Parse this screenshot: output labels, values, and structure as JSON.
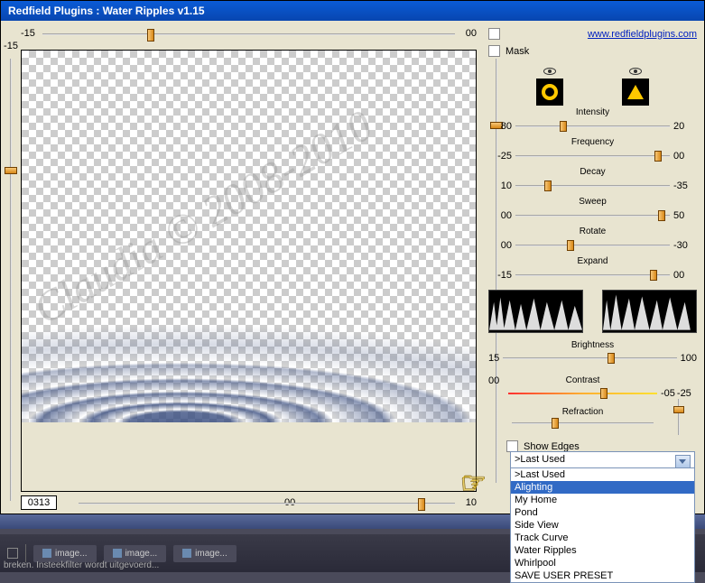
{
  "title": "Redfield Plugins : Water Ripples v1.15",
  "url": "www.redfieldplugins.com",
  "mask_label": "Mask",
  "show_edges_label": "Show Edges",
  "watermark": "Claudia © 2008-2010",
  "counter": "0313",
  "top_slider": {
    "left": "-15",
    "right": "00"
  },
  "left_slider": {
    "label": "-15"
  },
  "bottom_slider": {
    "left": "00",
    "right": "10"
  },
  "params": [
    {
      "name": "Intensity",
      "left": "80",
      "right": "20",
      "pos": 30
    },
    {
      "name": "Frequency",
      "left": "-25",
      "right": "00",
      "pos": 95
    },
    {
      "name": "Decay",
      "left": "10",
      "right": "-35",
      "pos": 20
    },
    {
      "name": "Sweep",
      "left": "00",
      "right": "50",
      "pos": 98
    },
    {
      "name": "Rotate",
      "left": "00",
      "right": "-30",
      "pos": 35
    },
    {
      "name": "Expand",
      "left": "-15",
      "right": "00",
      "pos": 92
    }
  ],
  "brightness": {
    "label": "Brightness",
    "left": "15",
    "right": "100",
    "pos": 60
  },
  "contrast": {
    "label": "Contrast",
    "left": "00",
    "pos": 62
  },
  "refraction": {
    "label": "Refraction",
    "val": "-05",
    "val2": "-25"
  },
  "dropdown": {
    "selected": ">Last Used",
    "items": [
      ">Last Used",
      "Alighting",
      "My Home",
      "Pond",
      "Side View",
      "Track Curve",
      "Water Ripples",
      "Whirlpool",
      "SAVE USER PRESET"
    ],
    "highlighted": 1
  },
  "taskbar": {
    "items": [
      "image...",
      "image...",
      "image..."
    ]
  },
  "status": "breken.   Insteekfilter wordt uitgevoerd..."
}
